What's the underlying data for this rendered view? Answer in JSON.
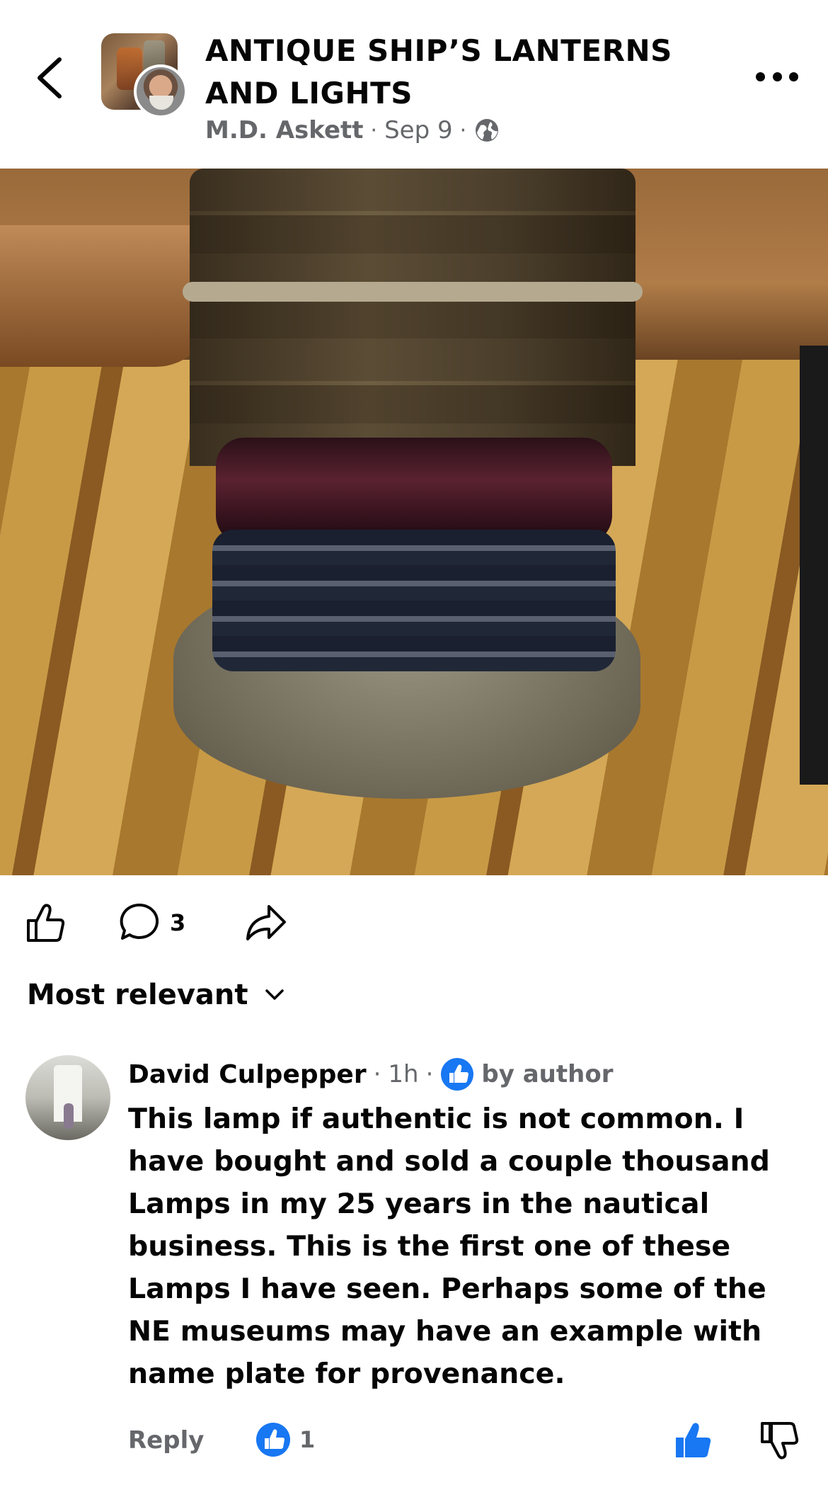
{
  "header": {
    "group_title": "ANTIQUE SHIP’S LANTERNS AND LIGHTS",
    "author": "M.D. Askett",
    "date": "Sep 9",
    "separator": "·",
    "privacy_icon": "globe-icon",
    "back_icon": "chevron-left-icon",
    "more_icon": "more-horizontal-icon"
  },
  "post": {
    "photo_alt": "antique ship lantern",
    "actions": {
      "like_icon": "thumbs-up-outline-icon",
      "comment_icon": "comment-bubble-icon",
      "comment_count": "3",
      "share_icon": "share-arrow-icon"
    }
  },
  "comments": {
    "sort_label": "Most relevant",
    "items": [
      {
        "name": "David Culpepper",
        "time": "1h",
        "badge": "by author",
        "text": "This lamp if authentic is not common. I have bought and sold a couple thousand Lamps in my 25 years in the nautical business. This is the first one of these Lamps I have seen. Perhaps some of the NE museums may have an example with name plate for provenance.",
        "reply_label": "Reply",
        "reaction_count": "1"
      }
    ]
  },
  "colors": {
    "text_primary": "#050505",
    "text_secondary": "#65676b",
    "facebook_blue": "#1877f2"
  }
}
